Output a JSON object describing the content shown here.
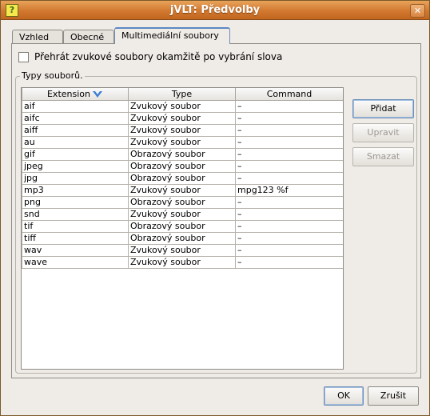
{
  "window": {
    "title": "jVLT: Předvolby",
    "close_glyph": "✕",
    "app_icon_glyph": "?"
  },
  "tabs": [
    {
      "label": "Vzhled",
      "active": false
    },
    {
      "label": "Obecné",
      "active": false
    },
    {
      "label": "Multimediální soubory",
      "active": true
    }
  ],
  "checkbox": {
    "label": "Přehrát zvukové soubory okamžitě po vybrání slova",
    "checked": false
  },
  "group": {
    "title": "Typy souborů."
  },
  "table": {
    "columns": [
      "Extension",
      "Type",
      "Command"
    ],
    "sort_column": "Extension",
    "sort_direction": "descending",
    "rows": [
      [
        "aif",
        "Zvukový soubor",
        "–"
      ],
      [
        "aifc",
        "Zvukový soubor",
        "–"
      ],
      [
        "aiff",
        "Zvukový soubor",
        "–"
      ],
      [
        "au",
        "Zvukový soubor",
        "–"
      ],
      [
        "gif",
        "Obrazový soubor",
        "–"
      ],
      [
        "jpeg",
        "Obrazový soubor",
        "–"
      ],
      [
        "jpg",
        "Obrazový soubor",
        "–"
      ],
      [
        "mp3",
        "Zvukový soubor",
        "mpg123 %f"
      ],
      [
        "png",
        "Obrazový soubor",
        "–"
      ],
      [
        "snd",
        "Zvukový soubor",
        "–"
      ],
      [
        "tif",
        "Obrazový soubor",
        "–"
      ],
      [
        "tiff",
        "Obrazový soubor",
        "–"
      ],
      [
        "wav",
        "Zvukový soubor",
        "–"
      ],
      [
        "wave",
        "Zvukový soubor",
        "–"
      ]
    ]
  },
  "side_buttons": {
    "add": "Přidat",
    "edit": "Upravit",
    "delete": "Smazat"
  },
  "footer": {
    "ok": "OK",
    "cancel": "Zrušit"
  },
  "colors": {
    "titlebar": "#d2782f",
    "active_tab": "#5b87c4",
    "sort_icon": "#3d7fd6"
  }
}
